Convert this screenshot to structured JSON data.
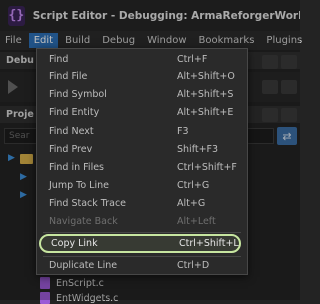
{
  "window": {
    "icon_glyph": "{}",
    "title": "Script Editor - Debugging: ArmaReforgerWorkbench.e"
  },
  "menubar": {
    "items": [
      "File",
      "Edit",
      "Build",
      "Debug",
      "Window",
      "Bookmarks",
      "Plugins"
    ]
  },
  "panels": {
    "debug_header": "Debu",
    "project_header": "Proje",
    "search_placeholder": "Sear"
  },
  "edit_menu": {
    "items": [
      {
        "label": "Find",
        "shortcut": "Ctrl+F"
      },
      {
        "label": "Find File",
        "shortcut": "Alt+Shift+O"
      },
      {
        "label": "Find Symbol",
        "shortcut": "Alt+Shift+S"
      },
      {
        "label": "Find Entity",
        "shortcut": "Alt+Shift+E"
      },
      {
        "label": "Find Next",
        "shortcut": "F3"
      },
      {
        "label": "Find Prev",
        "shortcut": "Shift+F3"
      },
      {
        "label": "Find in Files",
        "shortcut": "Ctrl+Shift+F"
      },
      {
        "label": "Jump To Line",
        "shortcut": "Ctrl+G"
      },
      {
        "label": "Find Stack Trace",
        "shortcut": "Alt+G"
      },
      {
        "label": "Navigate Back",
        "shortcut": "Alt+Left"
      },
      {
        "label": "Copy Link",
        "shortcut": "Ctrl+Shift+L"
      },
      {
        "label": "Duplicate Line",
        "shortcut": "Ctrl+D"
      }
    ]
  },
  "files": [
    "EnScript.c",
    "EntWidgets.c"
  ],
  "colors": {
    "menu_active": "#2d6fb6",
    "highlight_border": "#c7e6a0",
    "app_icon": "#c78cf5",
    "folder": "#d8b14a",
    "file_icon": "#9b5ad6"
  }
}
